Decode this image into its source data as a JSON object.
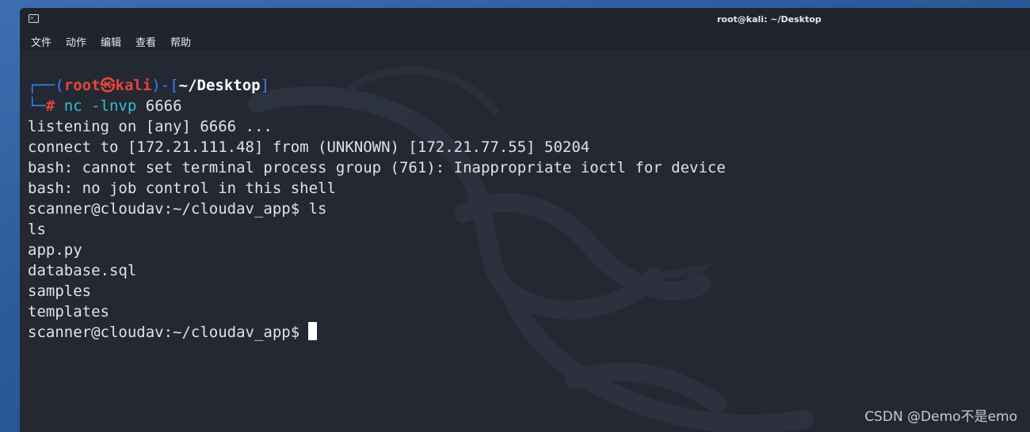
{
  "window": {
    "title": "root@kali: ~/Desktop",
    "icon": "terminal-icon"
  },
  "menu": [
    "文件",
    "动作",
    "编辑",
    "查看",
    "帮助"
  ],
  "prompt": {
    "box_top_left": "┌──(",
    "user": "root",
    "at_symbol": "㉿",
    "host": "kali",
    "sep": ")-[",
    "path": "~/Desktop",
    "close": "]",
    "box_bottom_left": "└─",
    "hash": "#",
    "command": "nc -lnvp",
    "arg": "6666"
  },
  "output_lines": [
    "listening on [any] 6666 ...",
    "connect to [172.21.111.48] from (UNKNOWN) [172.21.77.55] 50204",
    "bash: cannot set terminal process group (761): Inappropriate ioctl for device",
    "bash: no job control in this shell",
    "scanner@cloudav:~/cloudav_app$ ls",
    "ls",
    "app.py",
    "database.sql",
    "samples",
    "templates"
  ],
  "final_prompt": "scanner@cloudav:~/cloudav_app$",
  "watermark": "CSDN @Demo不是emo",
  "colors": {
    "terminal_bg": "#232833",
    "prompt_bracket": "#3b82f6",
    "prompt_user": "#e8443a",
    "command": "#35c0c8",
    "text": "#dfe3e8"
  }
}
